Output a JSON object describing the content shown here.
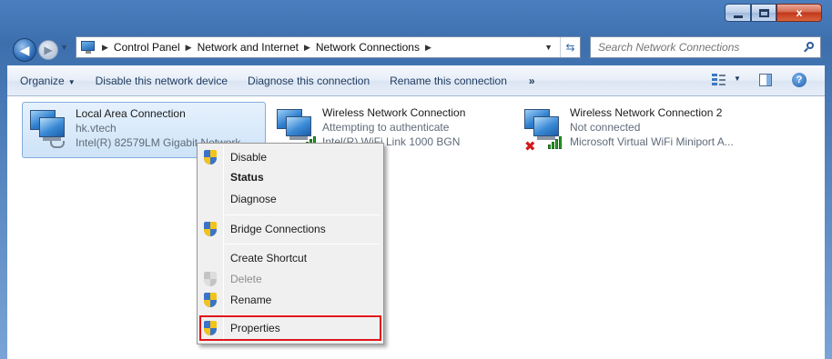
{
  "window": {
    "controls": {
      "minimize": "",
      "maximize": "",
      "close": "x"
    }
  },
  "address": {
    "crumbs": [
      "Control Panel",
      "Network and Internet",
      "Network Connections"
    ],
    "search_placeholder": "Search Network Connections"
  },
  "toolbar": {
    "organize": "Organize",
    "disable": "Disable this network device",
    "diagnose": "Diagnose this connection",
    "rename": "Rename this connection",
    "more": "»"
  },
  "connections": [
    {
      "name": "Local Area Connection",
      "status": "hk.vtech",
      "adapter": "Intel(R) 82579LM Gigabit Network...",
      "icon": "wired-network-icon",
      "selected": true
    },
    {
      "name": "Wireless Network Connection",
      "status": "Attempting to authenticate",
      "adapter": "Intel(R) WiFi Link 1000 BGN",
      "icon": "wireless-signal-icon",
      "selected": false
    },
    {
      "name": "Wireless Network Connection 2",
      "status": "Not connected",
      "adapter": "Microsoft Virtual WiFi Miniport A...",
      "icon": "wireless-disconnected-icon",
      "selected": false
    }
  ],
  "context_menu": {
    "items": [
      {
        "label": "Disable",
        "shield": true,
        "bold": false,
        "disabled": false
      },
      {
        "label": "Status",
        "shield": false,
        "bold": true,
        "disabled": false
      },
      {
        "label": "Diagnose",
        "shield": false,
        "bold": false,
        "disabled": false
      },
      {
        "label": "Bridge Connections",
        "shield": true,
        "bold": false,
        "disabled": false
      },
      {
        "label": "Create Shortcut",
        "shield": false,
        "bold": false,
        "disabled": false
      },
      {
        "label": "Delete",
        "shield": true,
        "bold": false,
        "disabled": true
      },
      {
        "label": "Rename",
        "shield": true,
        "bold": false,
        "disabled": false
      },
      {
        "label": "Properties",
        "shield": true,
        "bold": false,
        "disabled": false,
        "highlighted": true
      }
    ]
  },
  "colors": {
    "highlight_box": "#e0151d",
    "selection": "#cde3f8",
    "toolbar_text": "#1e3a5f"
  }
}
